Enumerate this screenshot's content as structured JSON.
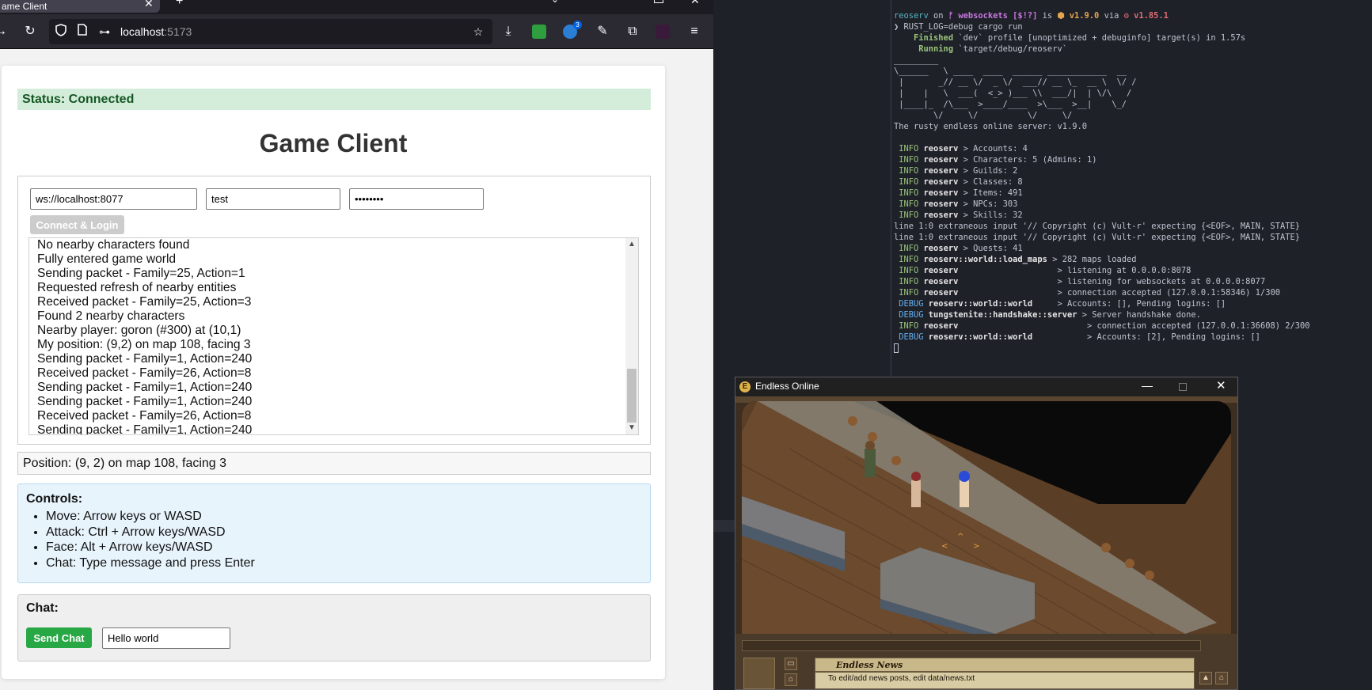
{
  "browser": {
    "tab_title": "ame Client",
    "url_host": "localhost",
    "url_port": ":5173",
    "ext_badge_count": "3"
  },
  "page": {
    "status": "Status: Connected",
    "title": "Game Client",
    "server_value": "ws://localhost:8077",
    "username_value": "test",
    "password_value": "••••••••",
    "connect_label": "Connect & Login",
    "log": [
      "No nearby characters found",
      "Fully entered game world",
      "Sending packet - Family=25, Action=1",
      "Requested refresh of nearby entities",
      "Received packet - Family=25, Action=3",
      "Found 2 nearby characters",
      "Nearby player: goron (#300) at (10,1)",
      "My position: (9,2) on map 108, facing 3",
      "Sending packet - Family=1, Action=240",
      "Received packet - Family=26, Action=8",
      "Sending packet - Family=1, Action=240",
      "Sending packet - Family=1, Action=240",
      "Received packet - Family=26, Action=8",
      "Sending packet - Family=1, Action=240"
    ],
    "position": "Position: (9, 2) on map 108, facing 3",
    "controls_title": "Controls:",
    "controls": [
      "Move: Arrow keys or WASD",
      "Attack: Ctrl + Arrow keys/WASD",
      "Face: Alt + Arrow keys/WASD",
      "Chat: Type message and press Enter"
    ],
    "chat_title": "Chat:",
    "send_label": "Send Chat",
    "chat_value": "Hello world"
  },
  "terminal": {
    "prompt": {
      "dir": "reoserv",
      "on": " on ",
      "branch": "ᚠ websockets [$!?]",
      "is": " is ",
      "pkg": "⬢ v1.9.0",
      "via": " via ",
      "rust": "⚙ v1.85.1"
    },
    "command": "❯ RUST_LOG=debug cargo run",
    "finished": {
      "label": "    Finished",
      "text": " `dev` profile [unoptimized + debuginfo] target(s) in 1.57s"
    },
    "running": {
      "label": "     Running",
      "text": " `target/debug/reoserv`"
    },
    "banner": [
      "_________",
      "\\______   \\ ____  ____  ______ ____________  __",
      " |       _// __ \\/  _ \\/  ___// __ \\_  __ \\  \\/ /",
      " |    |   \\  ___(  <_> )___ \\\\  ___/|  | \\/\\   /",
      " |____|_  /\\___  >____/____  >\\___  >__|    \\_/",
      "        \\/     \\/          \\/     \\/"
    ],
    "tagline": "The rusty endless online server: v1.9.0",
    "logs": [
      {
        "level": " INFO ",
        "target": "reoserv",
        "msg": " > Accounts: 4"
      },
      {
        "level": " INFO ",
        "target": "reoserv",
        "msg": " > Characters: 5 (Admins: 1)"
      },
      {
        "level": " INFO ",
        "target": "reoserv",
        "msg": " > Guilds: 2"
      },
      {
        "level": " INFO ",
        "target": "reoserv",
        "msg": " > Classes: 8"
      },
      {
        "level": " INFO ",
        "target": "reoserv",
        "msg": " > Items: 491"
      },
      {
        "level": " INFO ",
        "target": "reoserv",
        "msg": " > NPCs: 303"
      },
      {
        "level": " INFO ",
        "target": "reoserv",
        "msg": " > Skills: 32"
      },
      {
        "level": "",
        "target": "",
        "msg": "line 1:0 extraneous input '// Copyright (c) Vult-r' expecting {<EOF>, MAIN, STATE}"
      },
      {
        "level": "",
        "target": "",
        "msg": "line 1:0 extraneous input '// Copyright (c) Vult-r' expecting {<EOF>, MAIN, STATE}"
      },
      {
        "level": " INFO ",
        "target": "reoserv",
        "msg": " > Quests: 41"
      },
      {
        "level": " INFO ",
        "target": "reoserv::world::load_maps",
        "msg": " > 282 maps loaded"
      },
      {
        "level": " INFO ",
        "target": "reoserv",
        "msg": "                    > listening at 0.0.0.0:8078"
      },
      {
        "level": " INFO ",
        "target": "reoserv",
        "msg": "                    > listening for websockets at 0.0.0.0:8077"
      },
      {
        "level": " INFO ",
        "target": "reoserv",
        "msg": "                    > connection accepted (127.0.0.1:58346) 1/300"
      },
      {
        "level": " DEBUG ",
        "target": "reoserv::world::world",
        "msg": "     > Accounts: [], Pending logins: []"
      },
      {
        "level": " DEBUG ",
        "target": "tungstenite::handshake::server",
        "msg": " > Server handshake done."
      },
      {
        "level": " INFO ",
        "target": "reoserv",
        "msg": "                          > connection accepted (127.0.0.1:36608) 2/300"
      },
      {
        "level": " DEBUG ",
        "target": "reoserv::world::world",
        "msg": "           > Accounts: [2], Pending logins: []"
      }
    ]
  },
  "game": {
    "window_title": "Endless Online",
    "news_title": "Endless News",
    "news_text": "To edit/add news posts, edit data/news.txt",
    "hud_stars": "★★★★"
  },
  "colors": {
    "status_bg": "#d4edda",
    "status_text": "#155724",
    "send_button": "#28a745",
    "controls_bg": "#e8f4fc",
    "terminal_bg": "#1f2129"
  }
}
